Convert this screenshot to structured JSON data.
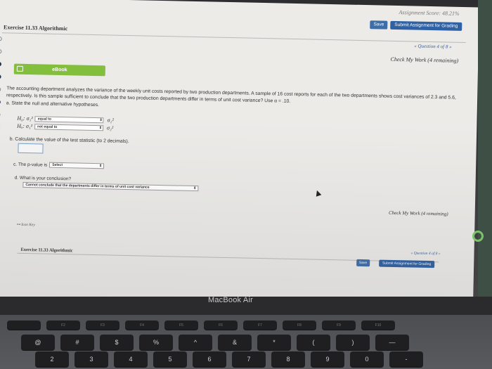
{
  "topbar": {
    "assignment_score": "Assignment Score: 48.21%",
    "save_label": "Save",
    "submit_label": "Submit Assignment for Grading"
  },
  "exercise": {
    "title": "Exercise 11.33 Algorithmic",
    "question_nav": "« Question 4 of 8 »",
    "check_my_work": "Check My Work (4 remaining)"
  },
  "ebook": {
    "label": "eBook"
  },
  "problem": {
    "text": "The accounting department analyzes the variance of the weekly unit costs reported by two production departments. A sample of 16 cost reports for each of the two departments shows cost variances of 2.3 and 5.6, respectively. Is this sample sufficient to conclude that the two production departments differ in terms of unit cost variance? Use α = .10."
  },
  "part_a": {
    "label": "a. State the null and alternative hypotheses.",
    "h0_lhs": "H₀: σ₁²",
    "h0_select": "equal to",
    "h0_rhs": "σ₂²",
    "ha_lhs": "Hₐ: σ₁²",
    "ha_select": "not equal to",
    "ha_rhs": "σ₂²"
  },
  "part_b": {
    "label": "b. Calculate the value of the test statistic (to 2 decimals).",
    "value": ""
  },
  "part_c": {
    "label_prefix": "c. The p-value is",
    "select": "Select"
  },
  "part_d": {
    "label": "d. What is your conclusion?",
    "select": "Cannot conclude that the departments differ in terms of unit cost variance"
  },
  "footer": {
    "check_my_work": "Check My Work (4 remaining)",
    "icon_key": "Icon Key",
    "title": "Exercise 11.33 Algorithmic",
    "question_nav": "« Question 4 of 8 »",
    "save_label": "Save",
    "submit_label": "Submit Assignment for Grading"
  },
  "device": {
    "brand": "MacBook Air",
    "keys_row1": [
      "",
      "F2",
      "F3",
      "F4",
      "F5",
      "F6",
      "F7",
      "F8",
      "F9",
      "F10"
    ],
    "keys_row2": [
      "@",
      "#",
      "$",
      "%",
      "^",
      "&",
      "*",
      "(",
      ")",
      "—"
    ],
    "keys_row2_sub": [
      "2",
      "3",
      "4",
      "5",
      "6",
      "7",
      "8",
      "9",
      "0",
      "-"
    ]
  },
  "colors": {
    "ebook_green": "#83bf3c",
    "button_blue": "#2f62a4",
    "link_blue": "#2f62a4"
  }
}
